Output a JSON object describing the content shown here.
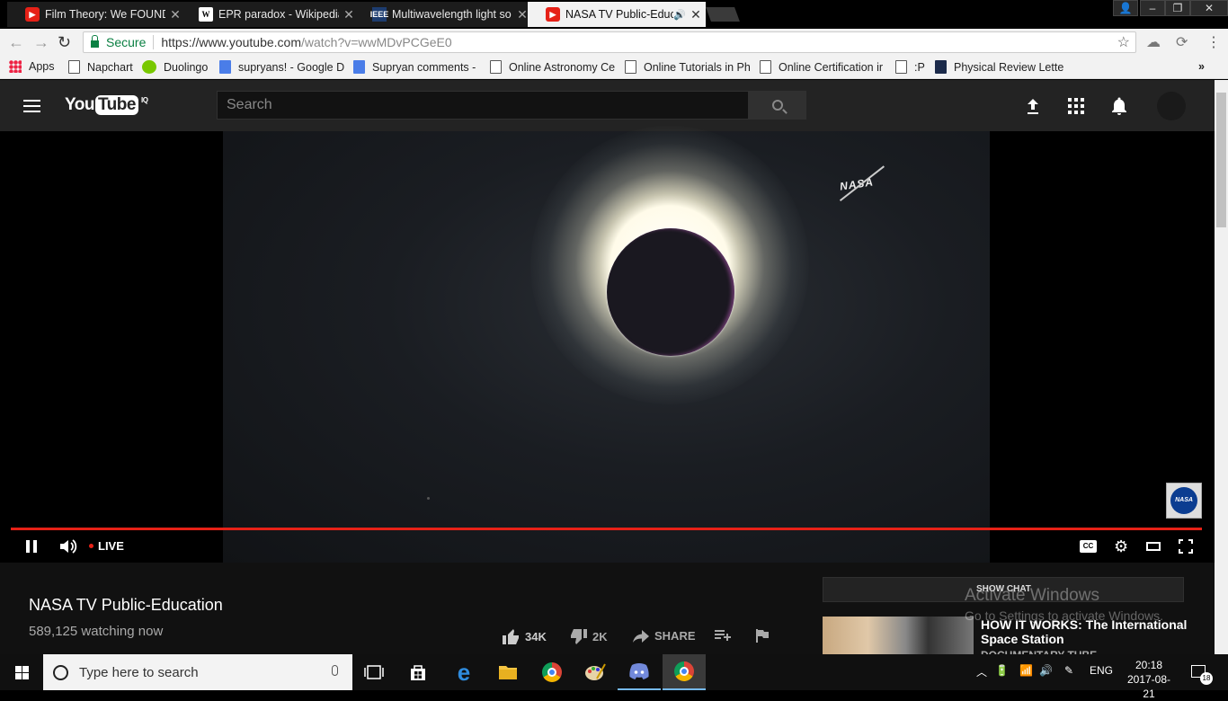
{
  "browser": {
    "tabs": [
      {
        "title": "Film Theory: We FOUND",
        "favicon": "youtube-icon",
        "active": false
      },
      {
        "title": "EPR paradox - Wikipedia",
        "favicon": "wikipedia-icon",
        "active": false
      },
      {
        "title": "Multiwavelength light so",
        "favicon": "ieee-icon",
        "active": false
      },
      {
        "title": "NASA TV Public-Educ",
        "favicon": "youtube-icon",
        "active": true
      }
    ],
    "ieee_label": "IEEE",
    "wiki_label": "W",
    "secure_label": "Secure",
    "url_main": "https://www.youtube.com",
    "url_rest": "/watch?v=wwMDvPCGeE0",
    "bookmarks": [
      {
        "label": "Apps"
      },
      {
        "label": "Napchart"
      },
      {
        "label": "Duolingo"
      },
      {
        "label": "supryans! - Google D"
      },
      {
        "label": "Supryan comments -"
      },
      {
        "label": "Online Astronomy Ce"
      },
      {
        "label": "Online Tutorials in Ph"
      },
      {
        "label": "Online Certification ir"
      },
      {
        "label": ":P"
      },
      {
        "label": "Physical Review Lette"
      }
    ],
    "bookmarks_more": "»",
    "accent": "#e62117"
  },
  "youtube": {
    "logo_you": "You",
    "logo_tube": "Tube",
    "logo_sup": "IQ",
    "search_placeholder": "Search",
    "player": {
      "watermark": "NASA",
      "badge": "NASA",
      "live_label": "LIVE",
      "cc_label": "CC",
      "progress_fraction": 1.0
    },
    "video": {
      "title": "NASA TV Public-Education",
      "watching": "589,125 watching now",
      "likes": "34K",
      "dislikes": "2K",
      "share_label": "SHARE"
    },
    "chat_button": "SHOW CHAT",
    "recommended": {
      "title": "HOW IT WORKS: The International Space Station",
      "channel_cut": "DOCUMENTARY TUBE"
    }
  },
  "windows": {
    "activate_title": "Activate Windows",
    "activate_subtitle": "Go to Settings to activate Windows.",
    "search_placeholder": "Type here to search",
    "language": "ENG",
    "time": "20:18",
    "date": "2017-08-21",
    "notifications": "18"
  }
}
